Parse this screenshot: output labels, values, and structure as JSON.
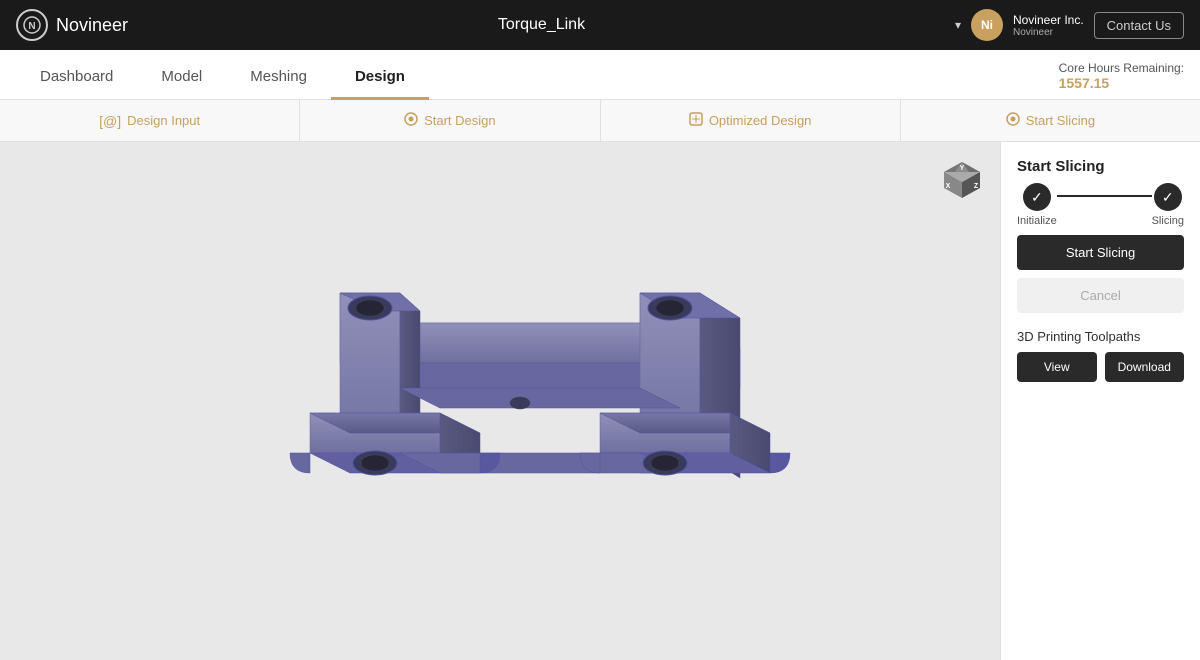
{
  "brand": {
    "logo_symbol": "N",
    "name": "Novineer"
  },
  "nav": {
    "title": "Torque_Link",
    "dropdown_icon": "▾",
    "user": {
      "initials": "Ni",
      "name": "Novineer Inc.",
      "sub": "Novineer"
    },
    "contact_label": "Contact Us"
  },
  "main_tabs": [
    {
      "id": "dashboard",
      "label": "Dashboard",
      "active": false
    },
    {
      "id": "model",
      "label": "Model",
      "active": false
    },
    {
      "id": "meshing",
      "label": "Meshing",
      "active": false
    },
    {
      "id": "design",
      "label": "Design",
      "active": true
    }
  ],
  "core_hours": {
    "label": "Core Hours Remaining:",
    "value": "1557.15"
  },
  "sub_tabs": [
    {
      "id": "design-input",
      "icon": "[@]",
      "label": "Design Input"
    },
    {
      "id": "start-design",
      "icon": "◎",
      "label": "Start Design"
    },
    {
      "id": "optimized-design",
      "icon": "⬡",
      "label": "Optimized Design"
    },
    {
      "id": "start-slicing",
      "icon": "◎",
      "label": "Start Slicing"
    }
  ],
  "right_panel": {
    "start_slicing": {
      "title": "Start Slicing",
      "steps": [
        {
          "id": "initialize",
          "label": "Initialize",
          "done": true
        },
        {
          "id": "slicing",
          "label": "Slicing",
          "done": true
        }
      ],
      "start_button_label": "Start Slicing",
      "cancel_button_label": "Cancel"
    },
    "toolpaths": {
      "label": "3D Printing Toolpaths",
      "view_label": "View",
      "download_label": "Download"
    }
  }
}
